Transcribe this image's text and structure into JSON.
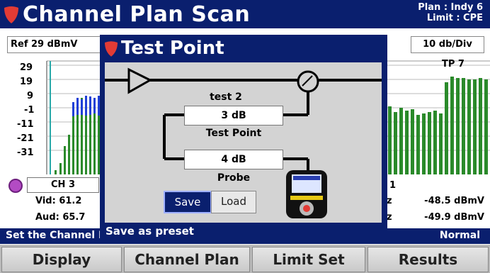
{
  "header": {
    "title": "Channel Plan Scan",
    "plan": "Plan : Indy 6",
    "limit": "Limit : CPE"
  },
  "ref_level": "Ref 29 dBmV",
  "scale": "10 db/Div",
  "chart": {
    "y_ticks": [
      "29",
      "19",
      "9",
      "-1",
      "-11",
      "-21",
      "-31"
    ],
    "test_point_label": "TP 7"
  },
  "channel": {
    "selector": "CH 3",
    "vid": "Vid: 61.2",
    "aud": "Aud: 65.7",
    "right_channel": "1",
    "right_vid_prefix": "z",
    "right_aud_prefix": "z",
    "vid_level": "-48.5 dBmV",
    "aud_level": "-49.9 dBmV"
  },
  "status": {
    "left": "Set the Channel Number",
    "right": "Normal"
  },
  "softkeys": [
    "Display",
    "Channel Plan",
    "Limit Set",
    "Results"
  ],
  "dialog": {
    "title": "Test Point",
    "preset_name": "test 2",
    "test_point_value": "3 dB",
    "test_point_label": "Test Point",
    "probe_value": "4 dB",
    "probe_label": "Probe",
    "save_label": "Save",
    "load_label": "Load",
    "footer": "Save as preset"
  },
  "colors": {
    "header_bg": "#0a1f6e",
    "green_bars": "#2a8a2a",
    "blue_bars": "#1f3fd6",
    "logo_red": "#e23b35"
  }
}
